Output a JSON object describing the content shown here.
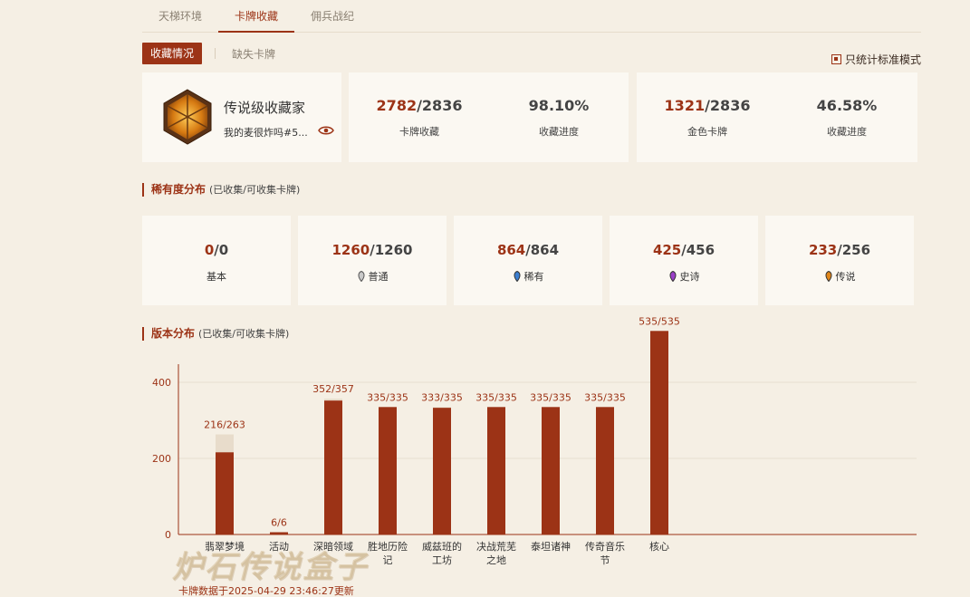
{
  "tabs": [
    {
      "label": "天梯环境",
      "active": false
    },
    {
      "label": "卡牌收藏",
      "active": true
    },
    {
      "label": "佣兵战纪",
      "active": false
    }
  ],
  "subtabs": {
    "active": "收藏情况",
    "other": "缺失卡牌"
  },
  "standard_toggle": "只统计标准模式",
  "profile": {
    "title": "传说级收藏家",
    "nickname": "我的麦很炸吗#5..."
  },
  "stats": [
    {
      "owned": "2782",
      "total": "/2836",
      "label": "卡牌收藏"
    },
    {
      "value": "98.10%",
      "label": "收藏进度"
    },
    {
      "owned": "1321",
      "total": "/2836",
      "label": "金色卡牌"
    },
    {
      "value": "46.58%",
      "label": "收藏进度"
    }
  ],
  "rarity_section": {
    "title": "稀有度分布",
    "sub": "(已收集/可收集卡牌)"
  },
  "rarity": [
    {
      "owned": "0",
      "total": "/0",
      "label": "基本",
      "gem": ""
    },
    {
      "owned": "1260",
      "total": "/1260",
      "label": "普通",
      "gem": "#b8b8b8"
    },
    {
      "owned": "864",
      "total": "/864",
      "label": "稀有",
      "gem": "#3c7fd1"
    },
    {
      "owned": "425",
      "total": "/456",
      "label": "史诗",
      "gem": "#9a3fc7"
    },
    {
      "owned": "233",
      "total": "/256",
      "label": "传说",
      "gem": "#e0861a"
    }
  ],
  "version_section": {
    "title": "版本分布",
    "sub": "(已收集/可收集卡牌)"
  },
  "colors": {
    "accent": "#9c3316",
    "bar_remaining": "#e8dccb"
  },
  "chart_data": {
    "type": "bar",
    "categories": [
      "翡翠梦境",
      "活动",
      "深暗领域",
      "胜地历险记",
      "威兹班的工坊",
      "决战荒芜之地",
      "泰坦诸神",
      "传奇音乐节",
      "核心"
    ],
    "category_lines": [
      [
        "翡翠梦境"
      ],
      [
        "活动"
      ],
      [
        "深暗领域"
      ],
      [
        "胜地历险",
        "记"
      ],
      [
        "威兹班的",
        "工坊"
      ],
      [
        "决战荒芜",
        "之地"
      ],
      [
        "泰坦诸神"
      ],
      [
        "传奇音乐",
        "节"
      ],
      [
        "核心"
      ]
    ],
    "collected": [
      216,
      6,
      352,
      335,
      333,
      335,
      335,
      335,
      535
    ],
    "collectible": [
      263,
      6,
      357,
      335,
      335,
      335,
      335,
      335,
      535
    ],
    "data_labels": [
      "216/263",
      "6/6",
      "352/357",
      "335/335",
      "333/335",
      "335/335",
      "335/335",
      "335/335",
      "535/535"
    ],
    "yticks": [
      0,
      200,
      400
    ],
    "ylim": [
      0,
      450
    ]
  },
  "footer": "卡牌数据于2025-04-29 23:46:27更新",
  "watermark": "炉石传说盒子"
}
